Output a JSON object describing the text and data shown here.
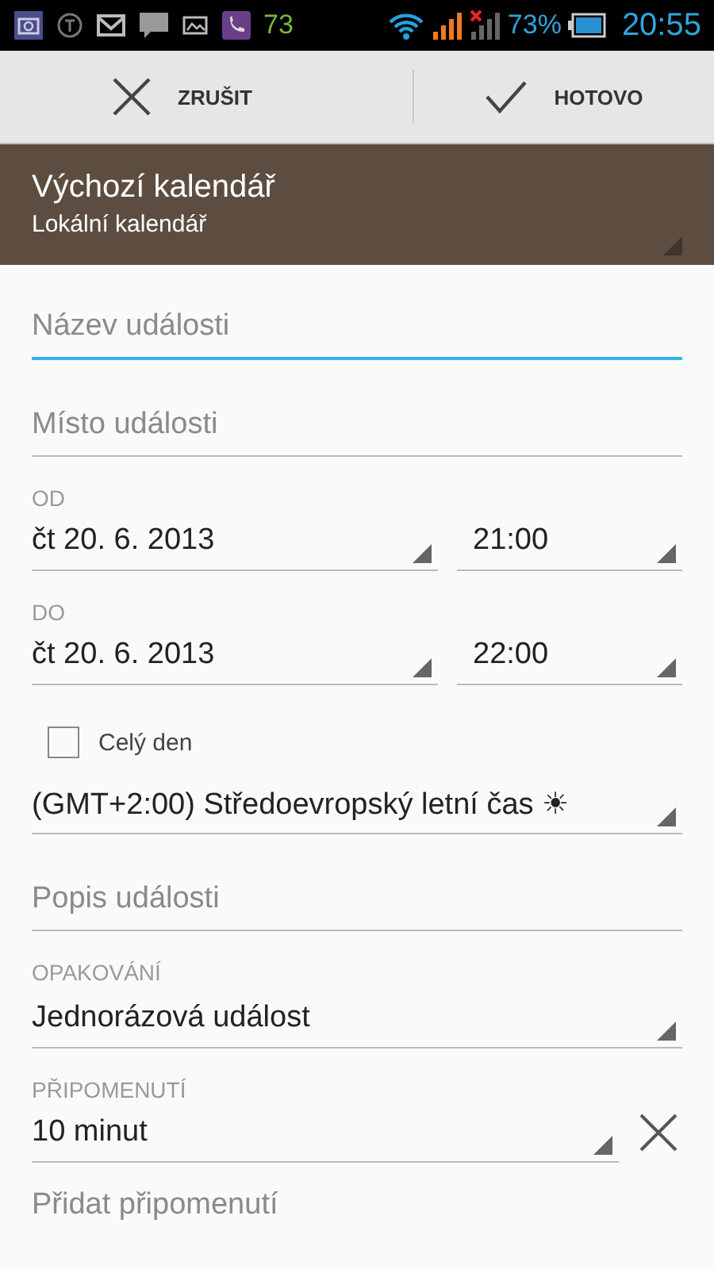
{
  "status_bar": {
    "counter": "73",
    "battery": "73%",
    "time": "20:55"
  },
  "action_bar": {
    "cancel": "ZRUŠIT",
    "done": "HOTOVO"
  },
  "calendar": {
    "title": "Výchozí kalendář",
    "subtitle": "Lokální kalendář"
  },
  "fields": [
    {
      "kind": "text",
      "placeholder": "Název události",
      "focused": true
    },
    {
      "kind": "text",
      "placeholder": "Místo události",
      "focused": false
    },
    {
      "kind": "datetime",
      "label": "OD",
      "date": "čt 20. 6. 2013",
      "time": "21:00"
    },
    {
      "kind": "datetime",
      "label": "DO",
      "date": "čt 20. 6. 2013",
      "time": "22:00"
    },
    {
      "kind": "checkbox",
      "label": "Celý den",
      "checked": false
    },
    {
      "kind": "spinner",
      "value": "(GMT+2:00) Středoevropský letní čas ☀"
    },
    {
      "kind": "text",
      "placeholder": "Popis události",
      "focused": false
    },
    {
      "kind": "spinner",
      "label": "OPAKOVÁNÍ",
      "value": "Jednorázová událost"
    },
    {
      "kind": "reminder",
      "label": "PŘIPOMENUTÍ",
      "value": "10 minut"
    },
    {
      "kind": "add",
      "label": "Přidat připomenutí"
    }
  ]
}
